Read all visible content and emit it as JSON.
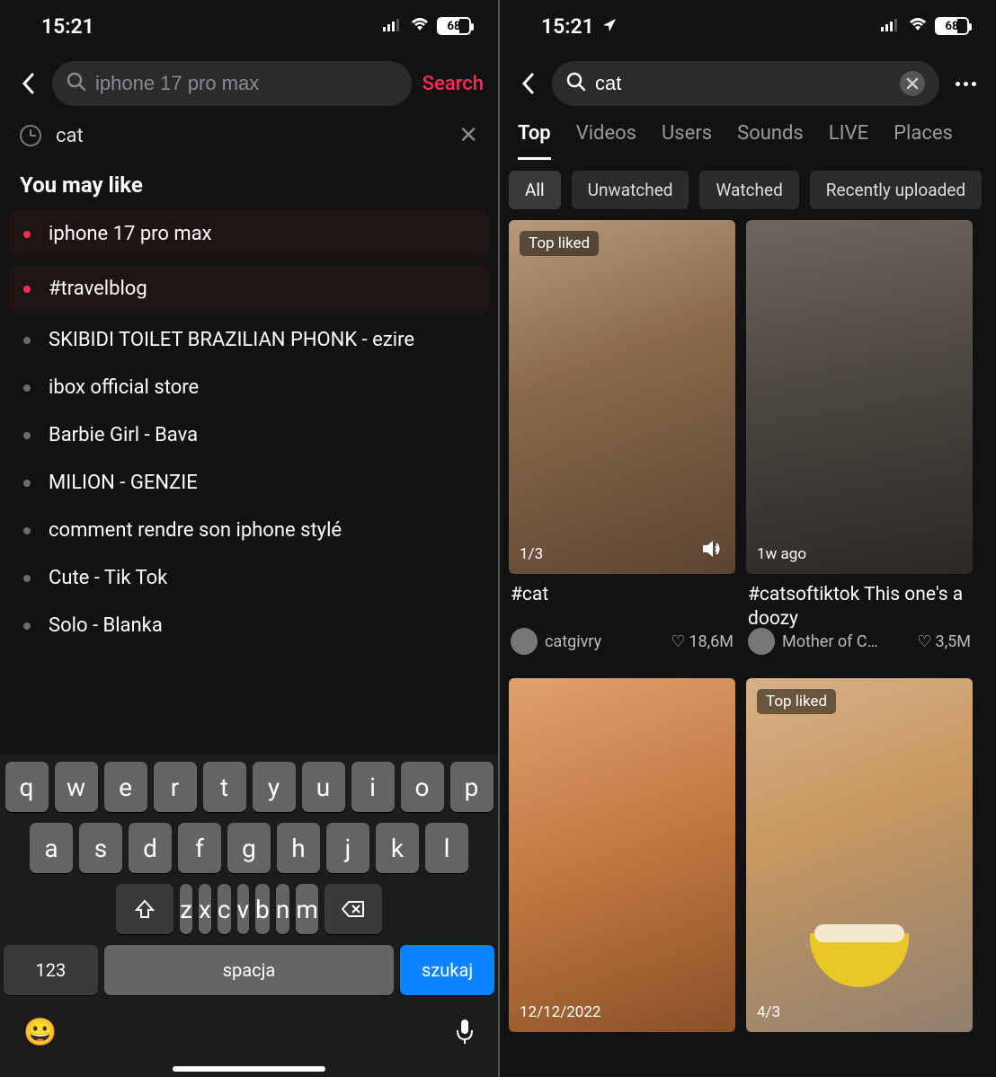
{
  "status": {
    "time": "15:21",
    "battery": "68"
  },
  "left": {
    "search_placeholder": "iphone 17 pro max",
    "search_action": "Search",
    "recent": "cat",
    "section": "You may like",
    "suggestions": [
      {
        "label": "iphone 17 pro max",
        "hot": true
      },
      {
        "label": "#travelblog",
        "hot": true
      },
      {
        "label": "SKIBIDI TOILET BRAZILIAN PHONK - ezire",
        "hot": false
      },
      {
        "label": "ibox official store",
        "hot": false
      },
      {
        "label": "Barbie Girl - Bava",
        "hot": false
      },
      {
        "label": "MILION - GENZIE",
        "hot": false
      },
      {
        "label": "comment rendre son iphone stylé",
        "hot": false
      },
      {
        "label": "Cute - Tik Tok",
        "hot": false
      },
      {
        "label": "Solo - Blanka",
        "hot": false
      }
    ],
    "keyboard": {
      "row1": [
        "q",
        "w",
        "e",
        "r",
        "t",
        "y",
        "u",
        "i",
        "o",
        "p"
      ],
      "row2": [
        "a",
        "s",
        "d",
        "f",
        "g",
        "h",
        "j",
        "k",
        "l"
      ],
      "row3": [
        "z",
        "x",
        "c",
        "v",
        "b",
        "n",
        "m"
      ],
      "num": "123",
      "space": "spacja",
      "enter": "szukaj"
    }
  },
  "right": {
    "search_value": "cat",
    "tabs": [
      "Top",
      "Videos",
      "Users",
      "Sounds",
      "LIVE",
      "Places"
    ],
    "active_tab": 0,
    "filters": [
      "All",
      "Unwatched",
      "Watched",
      "Recently uploaded"
    ],
    "active_filter": 0,
    "top_liked_badge": "Top liked",
    "cards": [
      {
        "badge": "Top liked",
        "counter": "1/3",
        "caption": "#cat",
        "user": "catgivry",
        "likes": "18,6M",
        "timestamp": ""
      },
      {
        "badge": "",
        "counter": "",
        "caption": "#catsoftiktok This one's a doozy",
        "user": "Mother of C…",
        "likes": "3,5M",
        "timestamp": "1w ago"
      },
      {
        "badge": "",
        "counter": "",
        "caption": "",
        "user": "",
        "likes": "",
        "timestamp": "12/12/2022"
      },
      {
        "badge": "Top liked",
        "counter": "4/3",
        "caption": "",
        "user": "",
        "likes": "",
        "timestamp": ""
      }
    ]
  }
}
